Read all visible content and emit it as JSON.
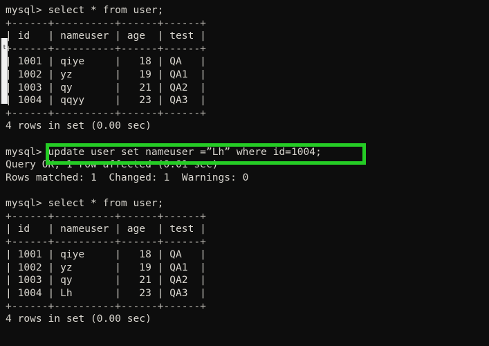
{
  "terminal": {
    "background_color": "#0d0d0d",
    "text_color": "#d9d6cf",
    "highlight_color": "#25cc25",
    "lines": [
      {
        "id": "l01",
        "text": "mysql> select * from user;"
      },
      {
        "id": "l02",
        "text": "+------+----------+------+------+"
      },
      {
        "id": "l03",
        "text": "| id   | nameuser | age  | test |"
      },
      {
        "id": "l04",
        "text": "+------+----------+------+------+"
      },
      {
        "id": "l05",
        "text": "| 1001 | qiye     |   18 | QA   |"
      },
      {
        "id": "l06",
        "text": "| 1002 | yz       |   19 | QA1  |"
      },
      {
        "id": "l07",
        "text": "| 1003 | qy       |   21 | QA2  |"
      },
      {
        "id": "l08",
        "text": "| 1004 | qqyy     |   23 | QA3  |"
      },
      {
        "id": "l09",
        "text": "+------+----------+------+------+"
      },
      {
        "id": "l10",
        "text": "4 rows in set (0.00 sec)"
      },
      {
        "id": "l11",
        "text": ""
      },
      {
        "id": "l12",
        "text": "mysql> update user set nameuser =”Lh” where id=1004;"
      },
      {
        "id": "l13",
        "text": "Query OK, 1 row affected (0.01 sec)"
      },
      {
        "id": "l14",
        "text": "Rows matched: 1  Changed: 1  Warnings: 0"
      },
      {
        "id": "l15",
        "text": ""
      },
      {
        "id": "l16",
        "text": "mysql> select * from user;"
      },
      {
        "id": "l17",
        "text": "+------+----------+------+------+"
      },
      {
        "id": "l18",
        "text": "| id   | nameuser | age  | test |"
      },
      {
        "id": "l19",
        "text": "+------+----------+------+------+"
      },
      {
        "id": "l20",
        "text": "| 1001 | qiye     |   18 | QA   |"
      },
      {
        "id": "l21",
        "text": "| 1002 | yz       |   19 | QA1  |"
      },
      {
        "id": "l22",
        "text": "| 1003 | qy       |   21 | QA2  |"
      },
      {
        "id": "l23",
        "text": "| 1004 | Lh       |   23 | QA3  |"
      },
      {
        "id": "l24",
        "text": "+------+----------+------+------+"
      },
      {
        "id": "l25",
        "text": "4 rows in set (0.00 sec)"
      }
    ],
    "commands": {
      "select_statement": "select * from user;",
      "update_statement": "update user set nameuser =”Lh” where id=1004;",
      "prompt": "mysql>"
    },
    "results": {
      "first_select_rowcount": "4 rows in set (0.00 sec)",
      "update_status": "Query OK, 1 row affected (0.01 sec)",
      "update_detail": "Rows matched: 1  Changed: 1  Warnings: 0",
      "second_select_rowcount": "4 rows in set (0.00 sec)"
    },
    "table_before": {
      "columns": [
        "id",
        "nameuser",
        "age",
        "test"
      ],
      "rows": [
        [
          "1001",
          "qiye",
          "18",
          "QA"
        ],
        [
          "1002",
          "yz",
          "19",
          "QA1"
        ],
        [
          "1003",
          "qy",
          "21",
          "QA2"
        ],
        [
          "1004",
          "qqyy",
          "23",
          "QA3"
        ]
      ]
    },
    "table_after": {
      "columns": [
        "id",
        "nameuser",
        "age",
        "test"
      ],
      "rows": [
        [
          "1001",
          "qiye",
          "18",
          "QA"
        ],
        [
          "1002",
          "yz",
          "19",
          "QA1"
        ],
        [
          "1003",
          "qy",
          "21",
          "QA2"
        ],
        [
          "1004",
          "Lh",
          "23",
          "QA3"
        ]
      ]
    }
  },
  "artifact": {
    "fragment_glyph": "t"
  }
}
